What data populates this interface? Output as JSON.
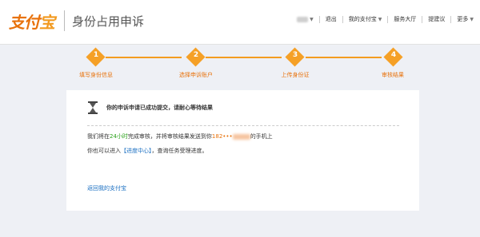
{
  "header": {
    "logo_text_a": "支付",
    "logo_text_b": "宝",
    "page_title": "身份占用申诉",
    "nav": {
      "logout": "退出",
      "my_alipay": "我的支付宝",
      "service_hall": "服务大厅",
      "suggest": "提建议",
      "more": "更多"
    }
  },
  "steps": [
    {
      "num": "1",
      "label": "填写身份信息"
    },
    {
      "num": "2",
      "label": "选择申诉账户"
    },
    {
      "num": "3",
      "label": "上传身份证"
    },
    {
      "num": "4",
      "label": "审核结果"
    }
  ],
  "result": {
    "title": "你的申诉申请已成功提交，请耐心等待结果",
    "line1_a": "我们将在",
    "line1_hours": "24小时",
    "line1_b": "完成审核，并将审核结果发送到你",
    "line1_phone_prefix": "182",
    "line1_phone_mask": "•••",
    "line1_c": "的手机上",
    "line2_a": "你也可以进入",
    "line2_link": "【进度中心】",
    "line2_b": "，查询任务受理进度。",
    "back_link": "返回我的支付宝"
  },
  "colors": {
    "accent": "#f39c1f",
    "link": "#1a6fc2",
    "green": "#2aa11a"
  }
}
